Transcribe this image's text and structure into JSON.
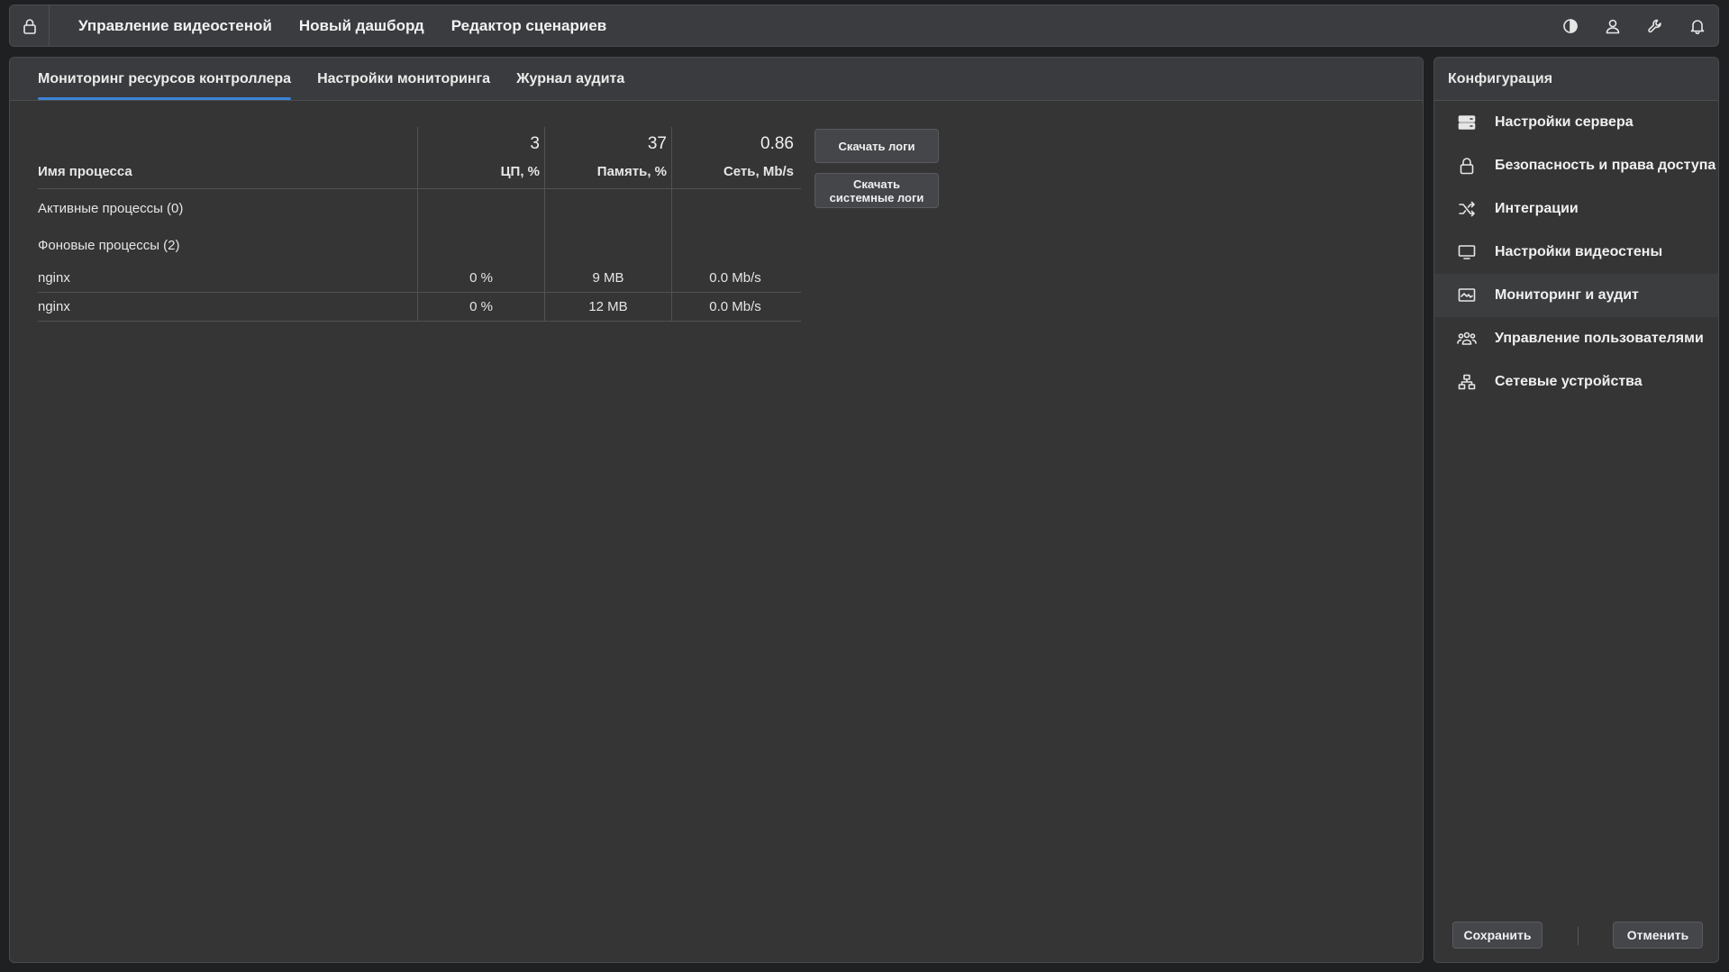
{
  "topbar": {
    "nav": [
      "Управление видеостеной",
      "Новый дашборд",
      "Редактор сценариев"
    ],
    "icons": [
      "lock-icon",
      "contrast-icon",
      "user-icon",
      "wrench-icon",
      "bell-icon"
    ]
  },
  "main": {
    "tabs": [
      "Мониторинг ресурсов контроллера",
      "Настройки мониторинга",
      "Журнал аудита"
    ],
    "active_tab": 0,
    "table": {
      "name_header": "Имя процесса",
      "columns": [
        {
          "total": "3",
          "label": "ЦП, %"
        },
        {
          "total": "37",
          "label": "Память, %"
        },
        {
          "total": "0.86",
          "label": "Сеть, Mb/s"
        }
      ],
      "groups": {
        "active": "Активные процессы (0)",
        "background": "Фоновые процессы (2)"
      },
      "rows": [
        {
          "name": "nginx",
          "cpu": "0 %",
          "mem": "9 MB",
          "net": "0.0 Mb/s"
        },
        {
          "name": "nginx",
          "cpu": "0 %",
          "mem": "12 MB",
          "net": "0.0 Mb/s"
        }
      ]
    },
    "buttons": {
      "download_logs": "Скачать логи",
      "download_system_logs": "Скачать системные логи"
    }
  },
  "side": {
    "title": "Конфигурация",
    "items": [
      {
        "label": "Настройки сервера",
        "icon": "server-icon"
      },
      {
        "label": "Безопасность и права доступа",
        "icon": "lock-icon"
      },
      {
        "label": "Интеграции",
        "icon": "shuffle-icon"
      },
      {
        "label": "Настройки видеостены",
        "icon": "monitor-icon"
      },
      {
        "label": "Мониторинг и аудит",
        "icon": "chart-monitor-icon"
      },
      {
        "label": "Управление пользователями",
        "icon": "users-icon"
      },
      {
        "label": "Сетевые устройства",
        "icon": "network-icon"
      }
    ],
    "active_item": 4,
    "save": "Сохранить",
    "cancel": "Отменить"
  },
  "colors": {
    "background": "#353536",
    "panel_header": "#3a3b3e",
    "accent": "#3b84d6",
    "text": "#f0f0f0"
  }
}
